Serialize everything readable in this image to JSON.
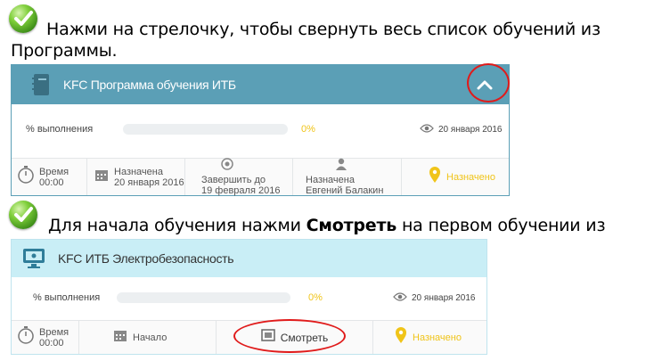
{
  "instructions": {
    "step1_line1": "Нажми на стрелочку, чтобы свернуть весь список обучений из",
    "step1_line2": "Программы.",
    "step2_pre": "Для начала обучения нажми ",
    "step2_bold": "Смотреть",
    "step2_post": " на первом обучении из списка"
  },
  "program_card": {
    "title": "KFC Программа обучения ИТБ",
    "progress_label": "% выполнения",
    "progress_value": 0,
    "progress_text": "0%",
    "date": "20 января 2016",
    "time_label": "Время",
    "time_value": "00:00",
    "assigned_label": "Назначена",
    "assigned_value": "20 января 2016",
    "finish_label": "Завершить до",
    "finish_value": "19 февраля 2016",
    "assigner_label": "Назначена",
    "assigner_value": "Евгений Балакин",
    "status": "Назначено",
    "header_color": "#5b9fb6",
    "icons": {
      "header": "notebook-icon",
      "collapse": "chevron-up-icon",
      "eye": "eye-icon",
      "clock": "clock-icon",
      "calendar": "calendar-icon",
      "target": "target-icon",
      "person": "person-icon",
      "status": "location-pin-icon"
    }
  },
  "course_card": {
    "title": "KFC ИТБ Электробезопасность",
    "progress_label": "% выполнения",
    "progress_value": 0,
    "progress_text": "0%",
    "date": "20 января 2016",
    "time_label": "Время",
    "time_value": "00:00",
    "start_label": "Начало",
    "watch_label": "Смотреть",
    "status": "Назначено",
    "header_color": "#c9eef6",
    "icons": {
      "header": "monitor-icon",
      "eye": "eye-icon",
      "clock": "clock-icon",
      "calendar": "calendar-icon",
      "watch": "film-icon",
      "status": "location-pin-icon"
    }
  },
  "colors": {
    "accent_yellow": "#f0c419",
    "highlight_red": "#e01b1b"
  }
}
